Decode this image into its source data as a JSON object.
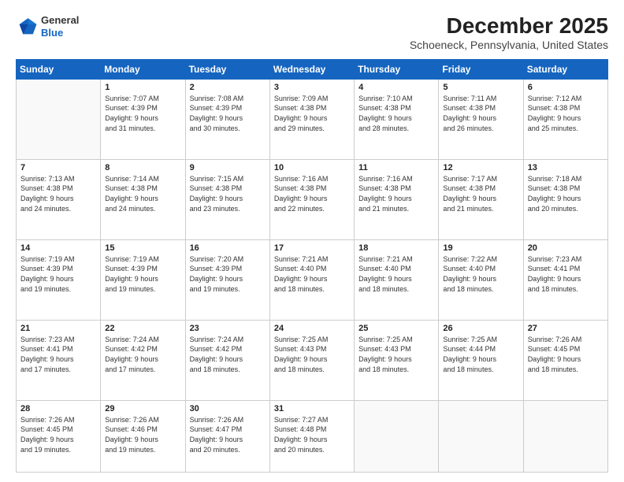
{
  "logo": {
    "general": "General",
    "blue": "Blue"
  },
  "title": "December 2025",
  "subtitle": "Schoeneck, Pennsylvania, United States",
  "days_header": [
    "Sunday",
    "Monday",
    "Tuesday",
    "Wednesday",
    "Thursday",
    "Friday",
    "Saturday"
  ],
  "weeks": [
    [
      {
        "day": "",
        "info": ""
      },
      {
        "day": "1",
        "info": "Sunrise: 7:07 AM\nSunset: 4:39 PM\nDaylight: 9 hours\nand 31 minutes."
      },
      {
        "day": "2",
        "info": "Sunrise: 7:08 AM\nSunset: 4:39 PM\nDaylight: 9 hours\nand 30 minutes."
      },
      {
        "day": "3",
        "info": "Sunrise: 7:09 AM\nSunset: 4:38 PM\nDaylight: 9 hours\nand 29 minutes."
      },
      {
        "day": "4",
        "info": "Sunrise: 7:10 AM\nSunset: 4:38 PM\nDaylight: 9 hours\nand 28 minutes."
      },
      {
        "day": "5",
        "info": "Sunrise: 7:11 AM\nSunset: 4:38 PM\nDaylight: 9 hours\nand 26 minutes."
      },
      {
        "day": "6",
        "info": "Sunrise: 7:12 AM\nSunset: 4:38 PM\nDaylight: 9 hours\nand 25 minutes."
      }
    ],
    [
      {
        "day": "7",
        "info": "Sunrise: 7:13 AM\nSunset: 4:38 PM\nDaylight: 9 hours\nand 24 minutes."
      },
      {
        "day": "8",
        "info": "Sunrise: 7:14 AM\nSunset: 4:38 PM\nDaylight: 9 hours\nand 24 minutes."
      },
      {
        "day": "9",
        "info": "Sunrise: 7:15 AM\nSunset: 4:38 PM\nDaylight: 9 hours\nand 23 minutes."
      },
      {
        "day": "10",
        "info": "Sunrise: 7:16 AM\nSunset: 4:38 PM\nDaylight: 9 hours\nand 22 minutes."
      },
      {
        "day": "11",
        "info": "Sunrise: 7:16 AM\nSunset: 4:38 PM\nDaylight: 9 hours\nand 21 minutes."
      },
      {
        "day": "12",
        "info": "Sunrise: 7:17 AM\nSunset: 4:38 PM\nDaylight: 9 hours\nand 21 minutes."
      },
      {
        "day": "13",
        "info": "Sunrise: 7:18 AM\nSunset: 4:38 PM\nDaylight: 9 hours\nand 20 minutes."
      }
    ],
    [
      {
        "day": "14",
        "info": "Sunrise: 7:19 AM\nSunset: 4:39 PM\nDaylight: 9 hours\nand 19 minutes."
      },
      {
        "day": "15",
        "info": "Sunrise: 7:19 AM\nSunset: 4:39 PM\nDaylight: 9 hours\nand 19 minutes."
      },
      {
        "day": "16",
        "info": "Sunrise: 7:20 AM\nSunset: 4:39 PM\nDaylight: 9 hours\nand 19 minutes."
      },
      {
        "day": "17",
        "info": "Sunrise: 7:21 AM\nSunset: 4:40 PM\nDaylight: 9 hours\nand 18 minutes."
      },
      {
        "day": "18",
        "info": "Sunrise: 7:21 AM\nSunset: 4:40 PM\nDaylight: 9 hours\nand 18 minutes."
      },
      {
        "day": "19",
        "info": "Sunrise: 7:22 AM\nSunset: 4:40 PM\nDaylight: 9 hours\nand 18 minutes."
      },
      {
        "day": "20",
        "info": "Sunrise: 7:23 AM\nSunset: 4:41 PM\nDaylight: 9 hours\nand 18 minutes."
      }
    ],
    [
      {
        "day": "21",
        "info": "Sunrise: 7:23 AM\nSunset: 4:41 PM\nDaylight: 9 hours\nand 17 minutes."
      },
      {
        "day": "22",
        "info": "Sunrise: 7:24 AM\nSunset: 4:42 PM\nDaylight: 9 hours\nand 17 minutes."
      },
      {
        "day": "23",
        "info": "Sunrise: 7:24 AM\nSunset: 4:42 PM\nDaylight: 9 hours\nand 18 minutes."
      },
      {
        "day": "24",
        "info": "Sunrise: 7:25 AM\nSunset: 4:43 PM\nDaylight: 9 hours\nand 18 minutes."
      },
      {
        "day": "25",
        "info": "Sunrise: 7:25 AM\nSunset: 4:43 PM\nDaylight: 9 hours\nand 18 minutes."
      },
      {
        "day": "26",
        "info": "Sunrise: 7:25 AM\nSunset: 4:44 PM\nDaylight: 9 hours\nand 18 minutes."
      },
      {
        "day": "27",
        "info": "Sunrise: 7:26 AM\nSunset: 4:45 PM\nDaylight: 9 hours\nand 18 minutes."
      }
    ],
    [
      {
        "day": "28",
        "info": "Sunrise: 7:26 AM\nSunset: 4:45 PM\nDaylight: 9 hours\nand 19 minutes."
      },
      {
        "day": "29",
        "info": "Sunrise: 7:26 AM\nSunset: 4:46 PM\nDaylight: 9 hours\nand 19 minutes."
      },
      {
        "day": "30",
        "info": "Sunrise: 7:26 AM\nSunset: 4:47 PM\nDaylight: 9 hours\nand 20 minutes."
      },
      {
        "day": "31",
        "info": "Sunrise: 7:27 AM\nSunset: 4:48 PM\nDaylight: 9 hours\nand 20 minutes."
      },
      {
        "day": "",
        "info": ""
      },
      {
        "day": "",
        "info": ""
      },
      {
        "day": "",
        "info": ""
      }
    ]
  ]
}
